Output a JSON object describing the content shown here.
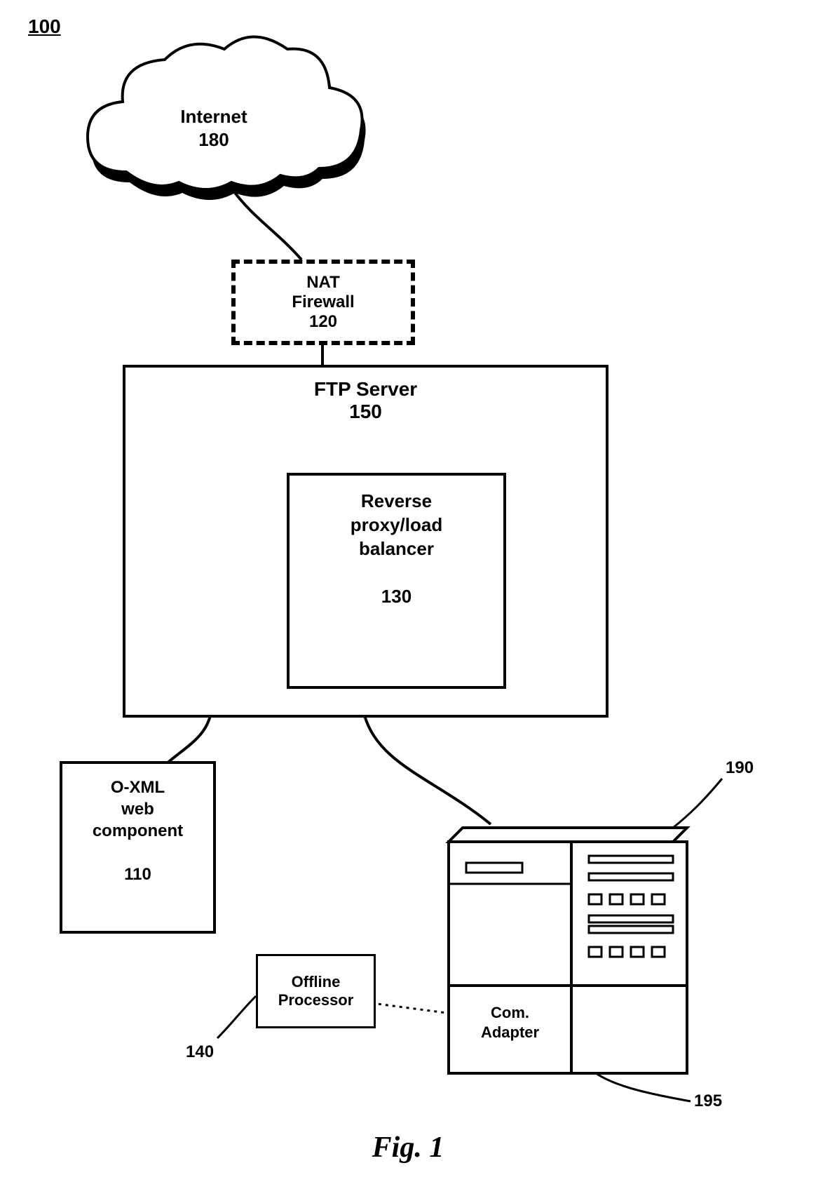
{
  "figure_ref": "100",
  "caption": "Fig. 1",
  "nodes": {
    "internet": {
      "label": "Internet",
      "ref": "180"
    },
    "nat": {
      "label": "NAT\nFirewall",
      "ref": "120"
    },
    "ftp": {
      "label": "FTP Server",
      "ref": "150"
    },
    "rplb": {
      "label": "Reverse\nproxy/load\nbalancer",
      "ref": "130"
    },
    "oxml": {
      "label": "O-XML\nweb\ncomponent",
      "ref": "110"
    },
    "offline": {
      "label": "Offline\nProcessor",
      "ref_callout": "140"
    },
    "computer": {
      "ref_callout": "190"
    },
    "com": {
      "label": "Com.\nAdapter",
      "ref_callout": "195"
    }
  }
}
